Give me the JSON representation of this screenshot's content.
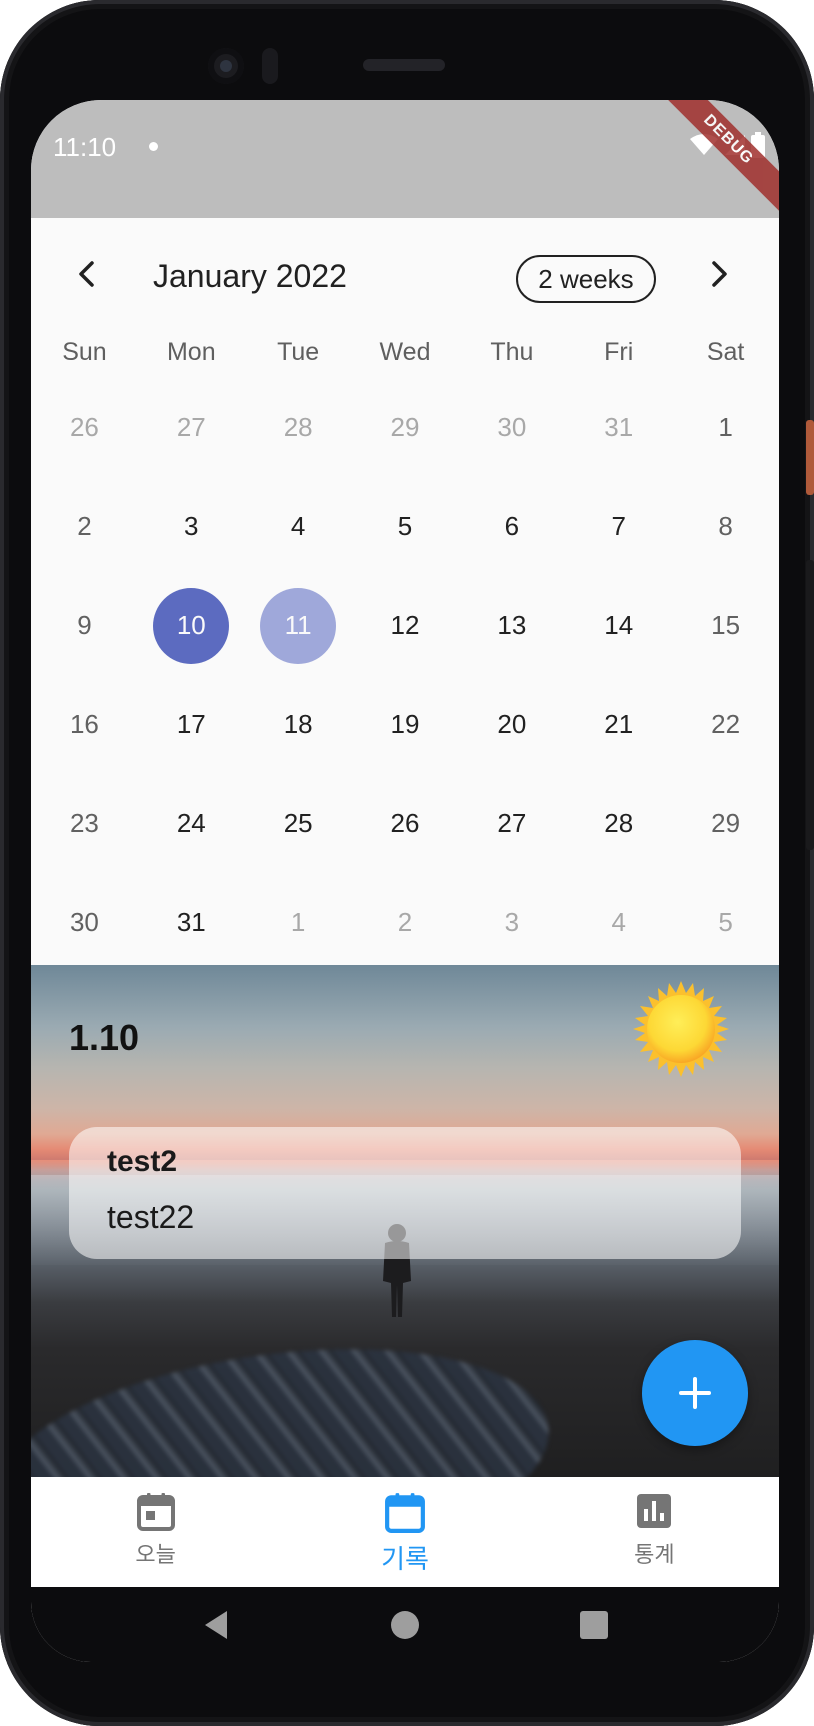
{
  "status_bar": {
    "time": "11:10",
    "debug_label": "DEBUG"
  },
  "calendar": {
    "month_title": "January 2022",
    "format_button": "2 weeks",
    "weekdays": [
      "Sun",
      "Mon",
      "Tue",
      "Wed",
      "Thu",
      "Fri",
      "Sat"
    ],
    "weeks": [
      [
        "26",
        "27",
        "28",
        "29",
        "30",
        "31",
        "1"
      ],
      [
        "2",
        "3",
        "4",
        "5",
        "6",
        "7",
        "8"
      ],
      [
        "9",
        "10",
        "11",
        "12",
        "13",
        "14",
        "15"
      ],
      [
        "16",
        "17",
        "18",
        "19",
        "20",
        "21",
        "22"
      ],
      [
        "23",
        "24",
        "25",
        "26",
        "27",
        "28",
        "29"
      ],
      [
        "30",
        "31",
        "1",
        "2",
        "3",
        "4",
        "5"
      ]
    ],
    "selected_color": "#5c6bc0",
    "today_color": "#9fa8da"
  },
  "entry_panel": {
    "date_label": "1.10",
    "weather_icon": "sun-icon",
    "entry": {
      "title": "test2",
      "body": "test22"
    },
    "fab_icon": "plus-icon",
    "fab_color": "#2196f3"
  },
  "bottom_nav": {
    "items": [
      {
        "label": "오늘",
        "icon": "calendar-today-icon"
      },
      {
        "label": "기록",
        "icon": "calendar-icon"
      },
      {
        "label": "통계",
        "icon": "bar-chart-icon"
      }
    ],
    "active_color": "#2196f3",
    "inactive_color": "#757575"
  }
}
